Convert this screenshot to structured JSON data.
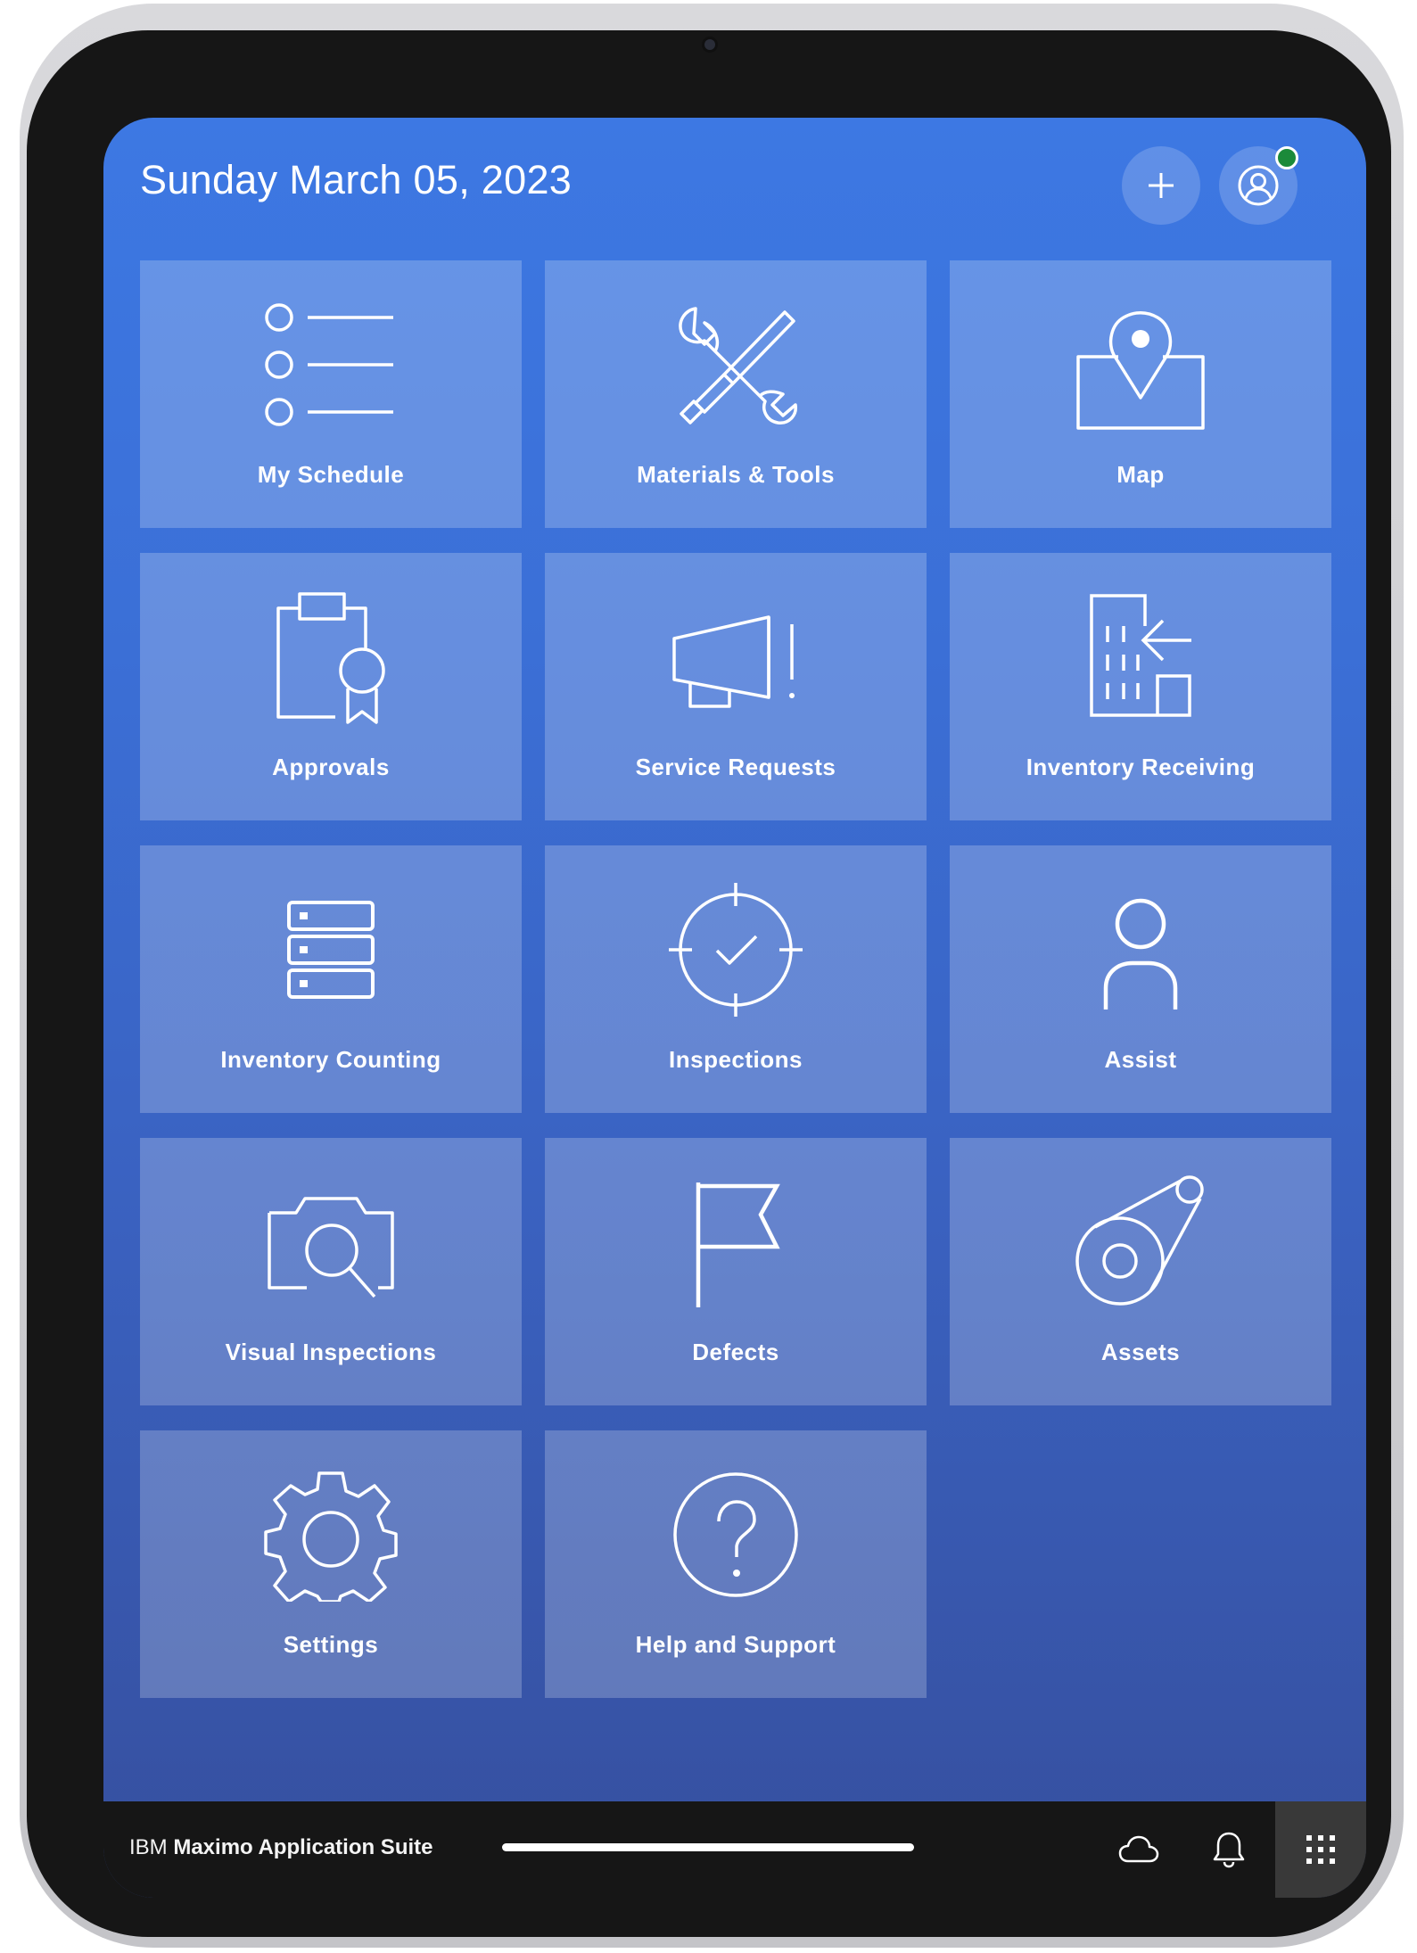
{
  "header": {
    "date": "Sunday March 05, 2023",
    "add_icon": "plus-icon",
    "profile_icon": "user-avatar-icon",
    "status_color": "#1b8a3a"
  },
  "tiles": [
    {
      "label": "My Schedule",
      "icon": "list-icon"
    },
    {
      "label": "Materials & Tools",
      "icon": "tools-icon"
    },
    {
      "label": "Map",
      "icon": "map-pin-icon"
    },
    {
      "label": "Approvals",
      "icon": "clipboard-certificate-icon"
    },
    {
      "label": "Service Requests",
      "icon": "megaphone-icon"
    },
    {
      "label": "Inventory Receiving",
      "icon": "building-receive-icon"
    },
    {
      "label": "Inventory Counting",
      "icon": "server-stack-icon"
    },
    {
      "label": "Inspections",
      "icon": "target-check-icon"
    },
    {
      "label": "Assist",
      "icon": "person-icon"
    },
    {
      "label": "Visual Inspections",
      "icon": "camera-search-icon"
    },
    {
      "label": "Defects",
      "icon": "flag-icon"
    },
    {
      "label": "Assets",
      "icon": "asset-pulley-icon"
    },
    {
      "label": "Settings",
      "icon": "gear-icon"
    },
    {
      "label": "Help and Support",
      "icon": "help-icon"
    }
  ],
  "bottom_bar": {
    "brand_prefix": "IBM",
    "brand_name": "Maximo Application Suite",
    "cloud_icon": "cloud-icon",
    "notifications_icon": "bell-icon",
    "apps_icon": "app-switcher-icon"
  },
  "colors": {
    "screen_top": "#3d78e3",
    "screen_bottom": "#364f9e",
    "bar": "#161616"
  }
}
